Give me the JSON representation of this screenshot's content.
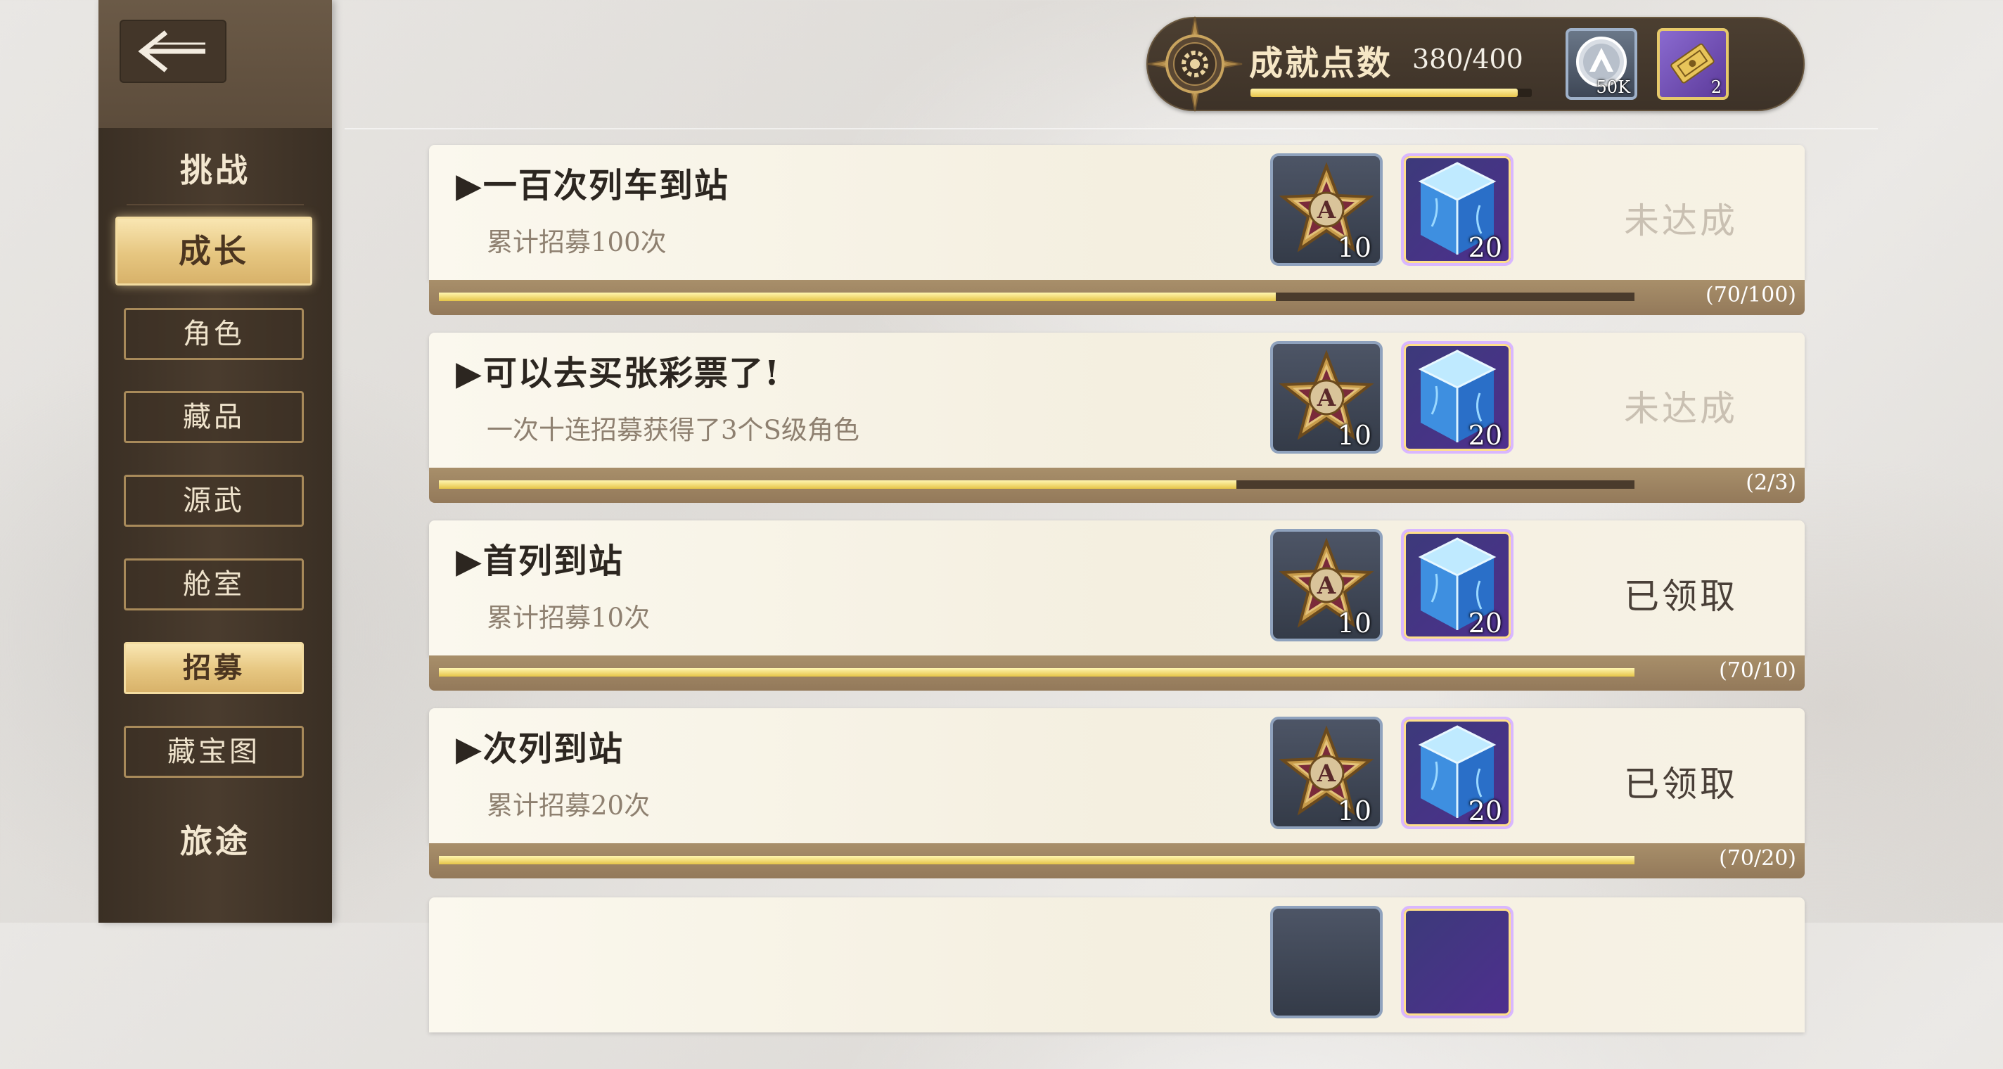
{
  "sidebar": {
    "back_label": "←",
    "categories": [
      {
        "label": "挑战"
      },
      {
        "label": "成长"
      },
      {
        "label": "旅途"
      }
    ],
    "items": [
      {
        "label": "角色"
      },
      {
        "label": "藏品"
      },
      {
        "label": "源武"
      },
      {
        "label": "舱室"
      },
      {
        "label": "招募"
      },
      {
        "label": "藏宝图"
      }
    ],
    "active_category": "成长",
    "active_item": "招募"
  },
  "header": {
    "points_label": "成就点数",
    "points_value": "380/400",
    "points_progress": 0.95,
    "resources": [
      {
        "icon": "silver-a-coin-icon",
        "count": "50K"
      },
      {
        "icon": "gold-ticket-icon",
        "count": "2"
      }
    ]
  },
  "achievements": [
    {
      "title": "▶一百次列车到站",
      "desc": "累计招募100次",
      "rewards": [
        {
          "icon": "a-star-medal-icon",
          "count": "10"
        },
        {
          "icon": "blue-crystal-cube-icon",
          "count": "20"
        }
      ],
      "status": "未达成",
      "progress_text": "(70/100)",
      "progress": 0.7
    },
    {
      "title": "▶可以去买张彩票了!",
      "desc": "一次十连招募获得了3个S级角色",
      "rewards": [
        {
          "icon": "a-star-medal-icon",
          "count": "10"
        },
        {
          "icon": "blue-crystal-cube-icon",
          "count": "20"
        }
      ],
      "status": "未达成",
      "progress_text": "(2/3)",
      "progress": 0.667
    },
    {
      "title": "▶首列到站",
      "desc": "累计招募10次",
      "rewards": [
        {
          "icon": "a-star-medal-icon",
          "count": "10"
        },
        {
          "icon": "blue-crystal-cube-icon",
          "count": "20"
        }
      ],
      "status": "已领取",
      "progress_text": "(70/10)",
      "progress": 1.0
    },
    {
      "title": "▶次列到站",
      "desc": "累计招募20次",
      "rewards": [
        {
          "icon": "a-star-medal-icon",
          "count": "10"
        },
        {
          "icon": "blue-crystal-cube-icon",
          "count": "20"
        }
      ],
      "status": "已领取",
      "progress_text": "(70/20)",
      "progress": 1.0
    }
  ],
  "colors": {
    "sidebar_bg": "#4a3c2e",
    "active_tab_gold": "#e6c680",
    "progress_gold": "#e6c548",
    "card_bg": "#f7f2e5",
    "status_todo": "#c9c0b2",
    "status_done": "#4a4038"
  }
}
